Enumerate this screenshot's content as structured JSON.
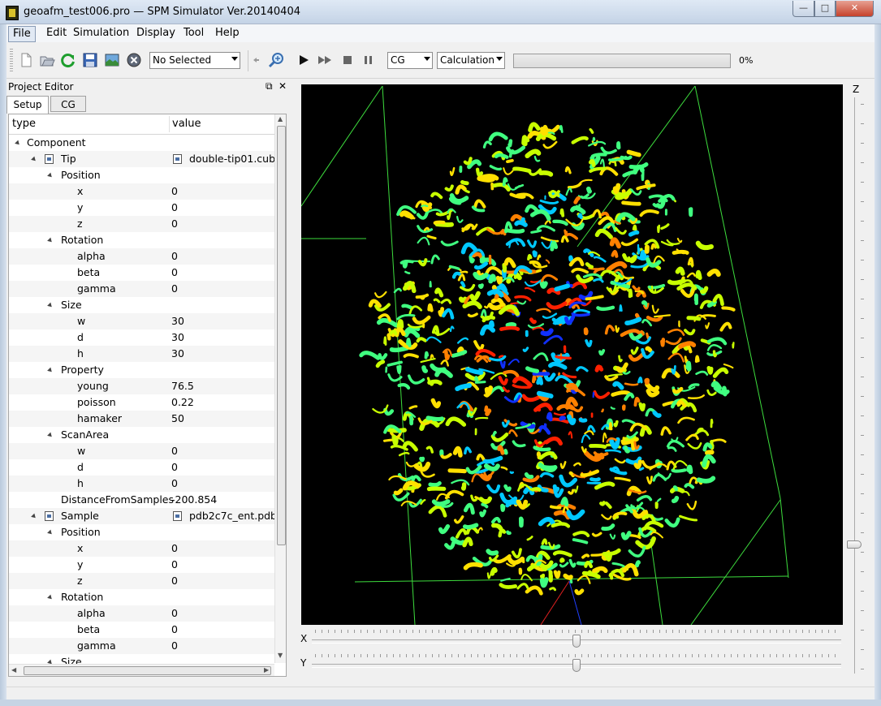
{
  "window": {
    "title": "geoafm_test006.pro — SPM Simulator Ver.20140404",
    "min": "—",
    "max": "□",
    "close": "✕"
  },
  "menu": [
    "File",
    "Edit",
    "Simulation",
    "Display",
    "Tool",
    "Help"
  ],
  "toolbar": {
    "selection_combo": "No Selected",
    "mode_combo": "CG",
    "calc_combo": "Calculation",
    "progress_value": 0,
    "progress_text": "0%"
  },
  "panel": {
    "title": "Project Editor",
    "float": "⧉",
    "close": "✕",
    "tabs": [
      "Setup",
      "CG"
    ],
    "header_type": "type",
    "header_value": "value",
    "rows": [
      {
        "label": "Component",
        "value": "",
        "level": 0,
        "expander": true,
        "icon": false
      },
      {
        "label": "Tip",
        "value": "double-tip01.cube",
        "level": 1,
        "expander": true,
        "icon": true
      },
      {
        "label": "Position",
        "value": "",
        "level": 2,
        "expander": true,
        "icon": false
      },
      {
        "label": "x",
        "value": "0",
        "level": 3,
        "expander": false,
        "icon": false
      },
      {
        "label": "y",
        "value": "0",
        "level": 3,
        "expander": false,
        "icon": false
      },
      {
        "label": "z",
        "value": "0",
        "level": 3,
        "expander": false,
        "icon": false
      },
      {
        "label": "Rotation",
        "value": "",
        "level": 2,
        "expander": true,
        "icon": false
      },
      {
        "label": "alpha",
        "value": "0",
        "level": 3,
        "expander": false,
        "icon": false
      },
      {
        "label": "beta",
        "value": "0",
        "level": 3,
        "expander": false,
        "icon": false
      },
      {
        "label": "gamma",
        "value": "0",
        "level": 3,
        "expander": false,
        "icon": false
      },
      {
        "label": "Size",
        "value": "",
        "level": 2,
        "expander": true,
        "icon": false
      },
      {
        "label": "w",
        "value": "30",
        "level": 3,
        "expander": false,
        "icon": false
      },
      {
        "label": "d",
        "value": "30",
        "level": 3,
        "expander": false,
        "icon": false
      },
      {
        "label": "h",
        "value": "30",
        "level": 3,
        "expander": false,
        "icon": false
      },
      {
        "label": "Property",
        "value": "",
        "level": 2,
        "expander": true,
        "icon": false
      },
      {
        "label": "young",
        "value": "76.5",
        "level": 3,
        "expander": false,
        "icon": false
      },
      {
        "label": "poisson",
        "value": "0.22",
        "level": 3,
        "expander": false,
        "icon": false
      },
      {
        "label": "hamaker",
        "value": "50",
        "level": 3,
        "expander": false,
        "icon": false
      },
      {
        "label": "ScanArea",
        "value": "",
        "level": 2,
        "expander": true,
        "icon": false
      },
      {
        "label": "w",
        "value": "0",
        "level": 3,
        "expander": false,
        "icon": false
      },
      {
        "label": "d",
        "value": "0",
        "level": 3,
        "expander": false,
        "icon": false
      },
      {
        "label": "h",
        "value": "0",
        "level": 3,
        "expander": false,
        "icon": false
      },
      {
        "label": "DistanceFromSamples",
        "value": "-200.854",
        "level": 2,
        "expander": false,
        "icon": false
      },
      {
        "label": "Sample",
        "value": "pdb2c7c_ent.pdb",
        "level": 1,
        "expander": true,
        "icon": true
      },
      {
        "label": "Position",
        "value": "",
        "level": 2,
        "expander": true,
        "icon": false
      },
      {
        "label": "x",
        "value": "0",
        "level": 3,
        "expander": false,
        "icon": false
      },
      {
        "label": "y",
        "value": "0",
        "level": 3,
        "expander": false,
        "icon": false
      },
      {
        "label": "z",
        "value": "0",
        "level": 3,
        "expander": false,
        "icon": false
      },
      {
        "label": "Rotation",
        "value": "",
        "level": 2,
        "expander": true,
        "icon": false
      },
      {
        "label": "alpha",
        "value": "0",
        "level": 3,
        "expander": false,
        "icon": false
      },
      {
        "label": "beta",
        "value": "0",
        "level": 3,
        "expander": false,
        "icon": false
      },
      {
        "label": "gamma",
        "value": "0",
        "level": 3,
        "expander": false,
        "icon": false
      },
      {
        "label": "Size",
        "value": "",
        "level": 2,
        "expander": true,
        "icon": false
      }
    ]
  },
  "viewer": {
    "z_label": "Z",
    "x_label": "X",
    "y_label": "Y",
    "z_level": 0.09,
    "x_level": 0.5,
    "y_level": 0.5
  },
  "colors": {
    "background": "#000000",
    "box_lines": "#3ddc3d",
    "protein": [
      "#1030ff",
      "#00c8ff",
      "#40ff80",
      "#c8ff00",
      "#ffe000",
      "#ff8000",
      "#ff2000"
    ]
  },
  "icons": [
    "new-file-icon",
    "open-folder-icon",
    "refresh-icon",
    "save-icon",
    "image-icon",
    "cancel-icon",
    "undo-icon",
    "zoom-icon",
    "play-icon",
    "fast-forward-icon",
    "stop-icon",
    "pause-icon"
  ]
}
